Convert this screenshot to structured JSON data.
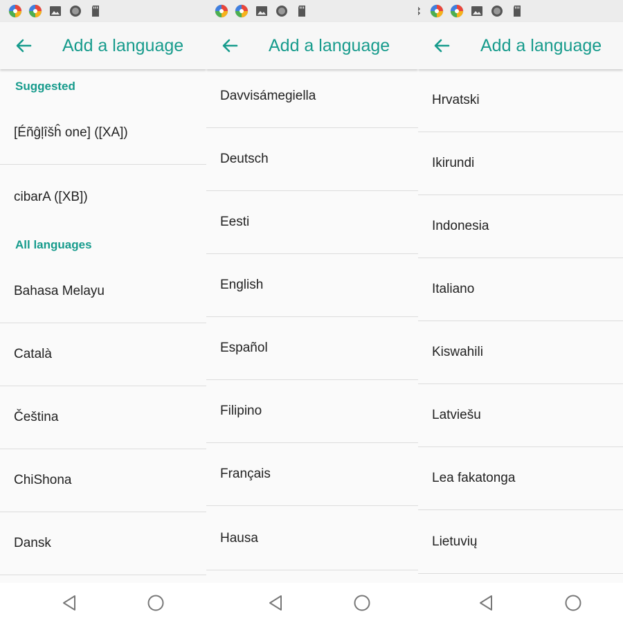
{
  "colors": {
    "accent": "#169b8c",
    "status_bar": "#ececec",
    "app_bar": "#f7f7f7",
    "list_bg": "#fafafa",
    "divider": "#dcdcdc"
  },
  "status_icons": [
    "multicolor-ball-icon",
    "multicolor-ball-icon",
    "image-icon",
    "circle-record-icon",
    "sd-card-icon"
  ],
  "panels": [
    {
      "appbar": {
        "title": "Add a language"
      },
      "sections": {
        "suggested_header": "Suggested",
        "suggested": [
          "[Éñĝļîšĥ one] ([XA])",
          "cibarA ([XB])"
        ],
        "all_header": "All languages",
        "all": [
          "Bahasa Melayu",
          "Català",
          "Čeština",
          "ChiShona",
          "Dansk"
        ]
      }
    },
    {
      "appbar": {
        "title": "Add a language"
      },
      "items": [
        "Davvisámegiella",
        "Deutsch",
        "Eesti",
        "English",
        "Español",
        "Filipino",
        "Français",
        "Hausa"
      ]
    },
    {
      "appbar": {
        "title": "Add a language"
      },
      "items": [
        "Hrvatski",
        "Ikirundi",
        "Indonesia",
        "Italiano",
        "Kiswahili",
        "Latviešu",
        "Lea fakatonga",
        "Lietuvių"
      ]
    }
  ]
}
